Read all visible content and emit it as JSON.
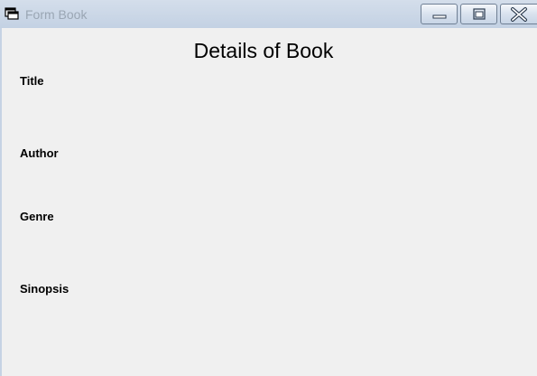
{
  "window": {
    "title": "Form Book"
  },
  "form": {
    "heading": "Details of Book",
    "labels": {
      "title": "Title",
      "author": "Author",
      "genre": "Genre",
      "sinopsis": "Sinopsis"
    }
  },
  "icons": {
    "app": "form-window-icon",
    "minimize": "minimize-icon",
    "maximize": "maximize-icon",
    "close": "close-icon"
  },
  "colors": {
    "titlebar": "#c6d3e4",
    "client_background": "#f0f0f0",
    "title_text": "#9aa6b4"
  }
}
